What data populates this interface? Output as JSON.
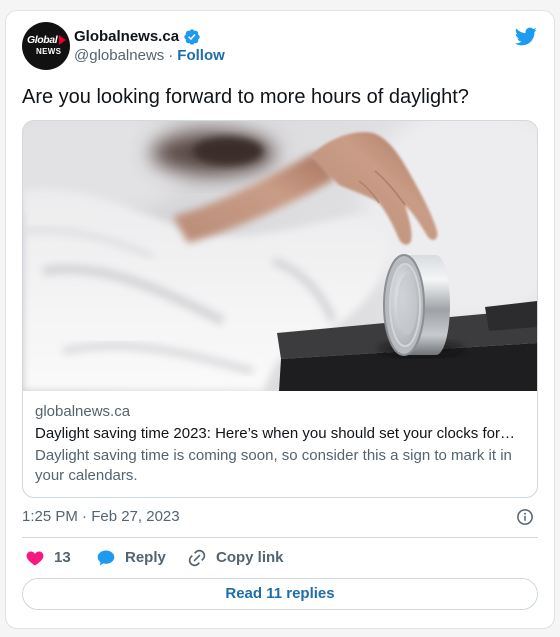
{
  "tweet": {
    "author": {
      "avatar_logo": {
        "line1": "Global",
        "line2": "NEWS"
      },
      "name": "Globalnews.ca",
      "handle": "@globalnews",
      "verified": true
    },
    "handle_separator": "·",
    "follow_label": "Follow",
    "text": "Are you looking forward to more hours of daylight?",
    "link_card": {
      "domain": "globalnews.ca",
      "title": "Daylight saving time 2023: Here’s when you should set your clocks for…",
      "description": "Daylight saving time is coming soon, so consider this a sign to mark it in your calendars."
    },
    "timestamp": "1:25 PM · Feb 27, 2023",
    "actions": {
      "like_count": "13",
      "reply_label": "Reply",
      "copy_link_label": "Copy link"
    },
    "read_replies_label": "Read 11 replies"
  },
  "icons": {
    "platform": "twitter-bird-icon",
    "verified": "verified-badge-icon",
    "info": "info-icon",
    "like": "heart-icon",
    "reply": "reply-bubble-icon",
    "copy_link": "link-icon"
  },
  "colors": {
    "page_background": "#f5f5f5",
    "card_border": "#cfd9de",
    "text_primary": "#0f1419",
    "text_secondary": "#536471",
    "brand_blue": "#1d9bf0",
    "link_blue": "#1d6fa9",
    "like_pink": "#f91880",
    "logo_red": "#e4002b"
  }
}
